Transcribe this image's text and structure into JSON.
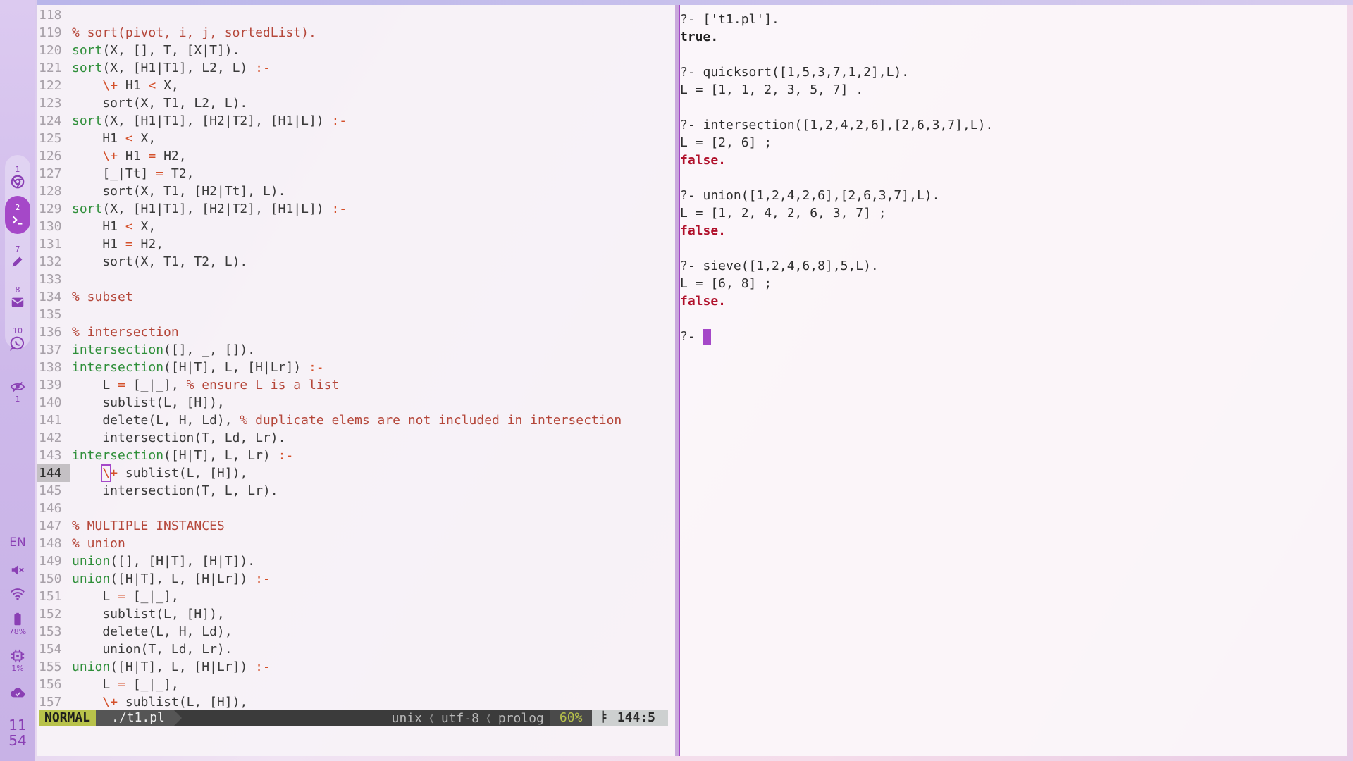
{
  "dock": {
    "workspaces": [
      {
        "num": "1",
        "icon": "chrome-icon"
      },
      {
        "num": "2",
        "icon": "terminal-icon"
      },
      {
        "num": "7",
        "icon": "pencil-icon"
      },
      {
        "num": "8",
        "icon": "mail-icon"
      },
      {
        "num": "10",
        "icon": "whatsapp-icon"
      },
      {
        "num": "1",
        "icon": "hidden-eye-icon"
      }
    ],
    "lang": "EN",
    "battery": "78%",
    "cpu": "1%",
    "clock_hour": "11",
    "clock_min": "54"
  },
  "editor": {
    "lines": [
      {
        "n": "118"
      },
      {
        "n": "119"
      },
      {
        "n": "120"
      },
      {
        "n": "121"
      },
      {
        "n": "122"
      },
      {
        "n": "123"
      },
      {
        "n": "124"
      },
      {
        "n": "125"
      },
      {
        "n": "126"
      },
      {
        "n": "127"
      },
      {
        "n": "128"
      },
      {
        "n": "129"
      },
      {
        "n": "130"
      },
      {
        "n": "131"
      },
      {
        "n": "132"
      },
      {
        "n": "133"
      },
      {
        "n": "134"
      },
      {
        "n": "135"
      },
      {
        "n": "136"
      },
      {
        "n": "137"
      },
      {
        "n": "138"
      },
      {
        "n": "139"
      },
      {
        "n": "140"
      },
      {
        "n": "141"
      },
      {
        "n": "142"
      },
      {
        "n": "143"
      },
      {
        "n": "144"
      },
      {
        "n": "145"
      },
      {
        "n": "146"
      },
      {
        "n": "147"
      },
      {
        "n": "148"
      },
      {
        "n": "149"
      },
      {
        "n": "150"
      },
      {
        "n": "151"
      },
      {
        "n": "152"
      },
      {
        "n": "153"
      },
      {
        "n": "154"
      },
      {
        "n": "155"
      },
      {
        "n": "156"
      },
      {
        "n": "157"
      }
    ],
    "code": {
      "l119": "% sort(pivot, i, j, sortedList).",
      "l120a": "sort",
      "l120b": "(X, [], T, [X|T]).",
      "l121a": "sort",
      "l121b": "(X, [H1|T1], L2, L) ",
      "l121c": ":-",
      "l122a": "    ",
      "l122b": "\\+",
      "l122c": " H1 ",
      "l122d": "<",
      "l122e": " X,",
      "l123": "    sort(X, T1, L2, L).",
      "l124a": "sort",
      "l124b": "(X, [H1|T1], [H2|T2], [H1|L]) ",
      "l124c": ":-",
      "l125a": "    H1 ",
      "l125b": "<",
      "l125c": " X,",
      "l126a": "    ",
      "l126b": "\\+",
      "l126c": " H1 ",
      "l126d": "=",
      "l126e": " H2,",
      "l127a": "    [_|Tt] ",
      "l127b": "=",
      "l127c": " T2,",
      "l128": "    sort(X, T1, [H2|Tt], L).",
      "l129a": "sort",
      "l129b": "(X, [H1|T1], [H2|T2], [H1|L]) ",
      "l129c": ":-",
      "l130a": "    H1 ",
      "l130b": "<",
      "l130c": " X,",
      "l131a": "    H1 ",
      "l131b": "=",
      "l131c": " H2,",
      "l132": "    sort(X, T1, T2, L).",
      "l134": "% subset",
      "l136": "% intersection",
      "l137a": "intersection",
      "l137b": "([], _, []).",
      "l138a": "intersection",
      "l138b": "([H|T], L, [H|Lr]) ",
      "l138c": ":-",
      "l139a": "    L ",
      "l139b": "=",
      "l139c": " [_|_], ",
      "l139d": "% ensure L is a list",
      "l140": "    sublist(L, [H]),",
      "l141a": "    delete(L, H, Ld), ",
      "l141b": "% duplicate elems are not included in intersection",
      "l142": "    intersection(T, Ld, Lr).",
      "l143a": "intersection",
      "l143b": "([H|T], L, Lr) ",
      "l143c": ":-",
      "l144a": "    ",
      "l144b": "\\",
      "l144c": "+",
      "l144d": " sublist(L, [H]),",
      "l145": "    intersection(T, L, Lr).",
      "l147": "% MULTIPLE INSTANCES",
      "l148": "% union",
      "l149a": "union",
      "l149b": "([], [H|T], [H|T]).",
      "l150a": "union",
      "l150b": "([H|T], L, [H|Lr]) ",
      "l150c": ":-",
      "l151a": "    L ",
      "l151b": "=",
      "l151c": " [_|_],",
      "l152": "    sublist(L, [H]),",
      "l153": "    delete(L, H, Ld),",
      "l154": "    union(T, Ld, Lr).",
      "l155a": "union",
      "l155b": "([H|T], L, [H|Lr]) ",
      "l155c": ":-",
      "l156a": "    L ",
      "l156b": "=",
      "l156c": " [_|_],",
      "l157a": "    ",
      "l157b": "\\+",
      "l157c": " sublist(L, [H]),"
    },
    "status": {
      "mode": "NORMAL",
      "file": "./t1.pl",
      "format": "unix",
      "encoding": "utf-8",
      "filetype": "prolog",
      "percent": "60%",
      "ln_icon": "ㅑ",
      "position": "144:5"
    }
  },
  "terminal": {
    "q1": "?- ['t1.pl'].",
    "r1": "true.",
    "q2": "?- quicksort([1,5,3,7,1,2],L).",
    "r2": "L = [1, 1, 2, 3, 5, 7] .",
    "q3": "?- intersection([1,2,4,2,6],[2,6,3,7],L).",
    "r3": "L = [2, 6] ;",
    "f3": "false.",
    "q4": "?- union([1,2,4,2,6],[2,6,3,7],L).",
    "r4": "L = [1, 2, 4, 2, 6, 3, 7] ;",
    "f4": "false.",
    "q5": "?- sieve([1,2,4,6,8],5,L).",
    "r5": "L = [6, 8] ;",
    "f5": "false.",
    "prompt": "?- "
  }
}
